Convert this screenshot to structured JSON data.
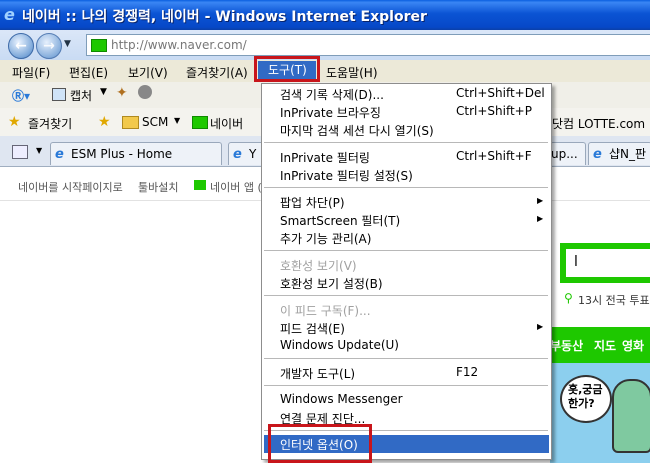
{
  "window": {
    "title": "네이버 :: 나의 경쟁력, 네이버 - Windows Internet Explorer"
  },
  "address": {
    "url": "http://www.naver.com/"
  },
  "menubar": {
    "items": [
      "파일(F)",
      "편집(E)",
      "보기(V)",
      "즐겨찾기(A)",
      "도구(T)",
      "도움말(H)"
    ]
  },
  "commandbar": {
    "capture_label": "캡처"
  },
  "favorites": {
    "label": "즐겨찾기",
    "items": [
      "SCM",
      "네이버"
    ],
    "right_item": "닷컴 LOTTE.com"
  },
  "tabs": {
    "items": [
      "ESM Plus - Home",
      "Y",
      "up...",
      "샵N_판"
    ]
  },
  "page": {
    "quicklinks": [
      "네이버를 시작페이지로",
      "툴바설치",
      "네이버 앱 ("
    ],
    "search_value": "l",
    "trend": "13시 전국 투표",
    "nav": [
      "부동산",
      "지도",
      "영화"
    ],
    "ad_text": "홋,궁금\n한가?"
  },
  "tools_menu": {
    "items": [
      {
        "label": "검색 기록 삭제(D)...",
        "shortcut": "Ctrl+Shift+Del"
      },
      {
        "label": "InPrivate 브라우징",
        "shortcut": "Ctrl+Shift+P"
      },
      {
        "label": "마지막 검색 세션 다시 열기(S)",
        "shortcut": ""
      },
      {
        "label": "InPrivate 필터링",
        "shortcut": "Ctrl+Shift+F"
      },
      {
        "label": "InPrivate 필터링 설정(S)",
        "shortcut": ""
      },
      {
        "label": "팝업 차단(P)",
        "shortcut": ""
      },
      {
        "label": "SmartScreen 필터(T)",
        "shortcut": ""
      },
      {
        "label": "추가 기능 관리(A)",
        "shortcut": ""
      },
      {
        "label": "호환성 보기(V)",
        "shortcut": ""
      },
      {
        "label": "호환성 보기 설정(B)",
        "shortcut": ""
      },
      {
        "label": "이 피드 구독(F)...",
        "shortcut": ""
      },
      {
        "label": "피드 검색(E)",
        "shortcut": ""
      },
      {
        "label": "Windows Update(U)",
        "shortcut": ""
      },
      {
        "label": "개발자 도구(L)",
        "shortcut": "F12"
      },
      {
        "label": "Windows Messenger",
        "shortcut": ""
      },
      {
        "label": "연결 문제 진단...",
        "shortcut": ""
      },
      {
        "label": "인터넷 옵션(O)",
        "shortcut": ""
      }
    ]
  },
  "colors": {
    "highlight": "#316ac5",
    "callout": "#c8151b",
    "naver_green": "#1ec800"
  }
}
